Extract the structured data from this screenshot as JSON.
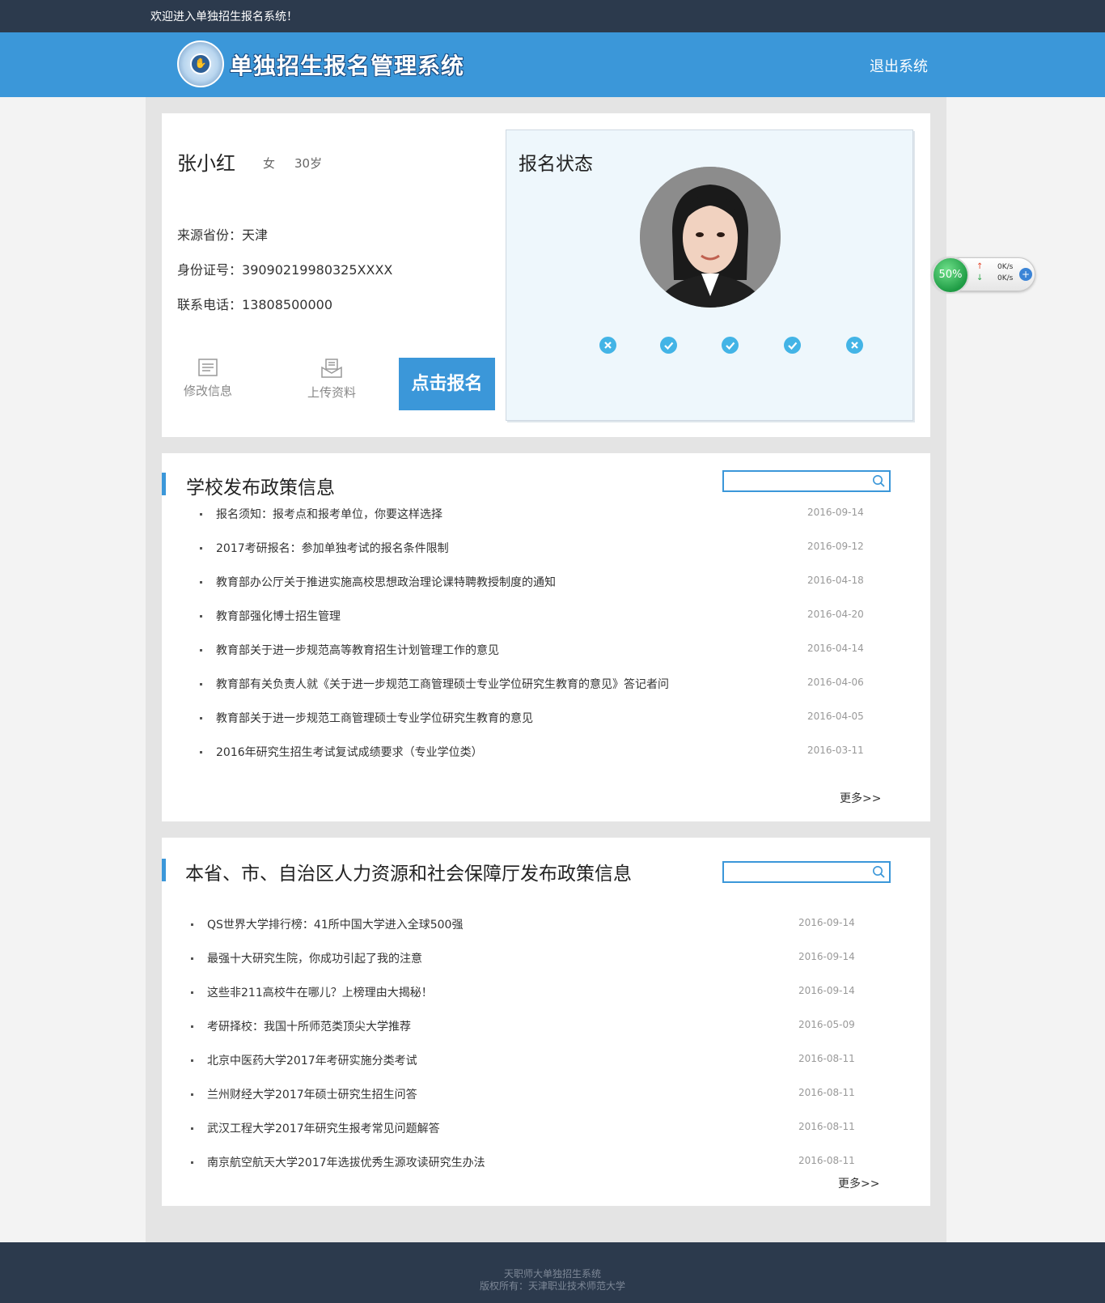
{
  "topbar": {
    "welcome": "欢迎进入单独招生报名系统！"
  },
  "header": {
    "title": "单独招生报名管理系统",
    "logout": "退出系统",
    "logo_icon": "school-seal-logo"
  },
  "profile": {
    "name": "张小红",
    "gender": "女",
    "age": "30岁",
    "province_label": "来源省份：",
    "province": "天津",
    "id_label": "身份证号：",
    "id_number": "39090219980325XXXX",
    "phone_label": "联系电话：",
    "phone": "13808500000",
    "edit_label": "修改信息",
    "upload_label": "上传资料",
    "signup_label": "点击报名"
  },
  "status": {
    "title": "报名状态",
    "steps": [
      {
        "state": "x"
      },
      {
        "state": "check"
      },
      {
        "state": "check"
      },
      {
        "state": "check"
      },
      {
        "state": "x"
      }
    ]
  },
  "news1": {
    "title": "学校发布政策信息",
    "search_placeholder": "",
    "more": "更多>>",
    "items": [
      {
        "title": "报名须知：报考点和报考单位，你要这样选择",
        "date": "2016-09-14"
      },
      {
        "title": "2017考研报名：参加单独考试的报名条件限制",
        "date": "2016-09-12"
      },
      {
        "title": "教育部办公厅关于推进实施高校思想政治理论课特聘教授制度的通知",
        "date": "2016-04-18"
      },
      {
        "title": "教育部强化博士招生管理",
        "date": "2016-04-20"
      },
      {
        "title": "教育部关于进一步规范高等教育招生计划管理工作的意见",
        "date": "2016-04-14"
      },
      {
        "title": "教育部有关负责人就《关于进一步规范工商管理硕士专业学位研究生教育的意见》答记者问",
        "date": "2016-04-06"
      },
      {
        "title": "教育部关于进一步规范工商管理硕士专业学位研究生教育的意见",
        "date": "2016-04-05"
      },
      {
        "title": "2016年研究生招生考试复试成绩要求（专业学位类）",
        "date": "2016-03-11"
      }
    ]
  },
  "news2": {
    "title": "本省、市、自治区人力资源和社会保障厅发布政策信息",
    "search_placeholder": "",
    "more": "更多>>",
    "items": [
      {
        "title": "QS世界大学排行榜：41所中国大学进入全球500强",
        "date": "2016-09-14"
      },
      {
        "title": "最强十大研究生院，你成功引起了我的注意",
        "date": "2016-09-14"
      },
      {
        "title": "这些非211高校牛在哪儿？上榜理由大揭秘！",
        "date": "2016-09-14"
      },
      {
        "title": "考研择校：我国十所师范类顶尖大学推荐",
        "date": "2016-05-09"
      },
      {
        "title": "北京中医药大学2017年考研实施分类考试",
        "date": "2016-08-11"
      },
      {
        "title": "兰州财经大学2017年硕士研究生招生问答",
        "date": "2016-08-11"
      },
      {
        "title": "武汉工程大学2017年研究生报考常见问题解答",
        "date": "2016-08-11"
      },
      {
        "title": "南京航空航天大学2017年选拔优秀生源攻读研究生办法",
        "date": "2016-08-11"
      }
    ]
  },
  "widget": {
    "percent": "50%",
    "up_speed": "0K/s",
    "down_speed": "0K/s"
  },
  "footer": {
    "line1": "天职师大单独招生系统",
    "line2": "版权所有：天津职业技术师范大学"
  },
  "colors": {
    "primary": "#3b97d9",
    "dark": "#2c3a4d",
    "step": "#43b4e6"
  }
}
